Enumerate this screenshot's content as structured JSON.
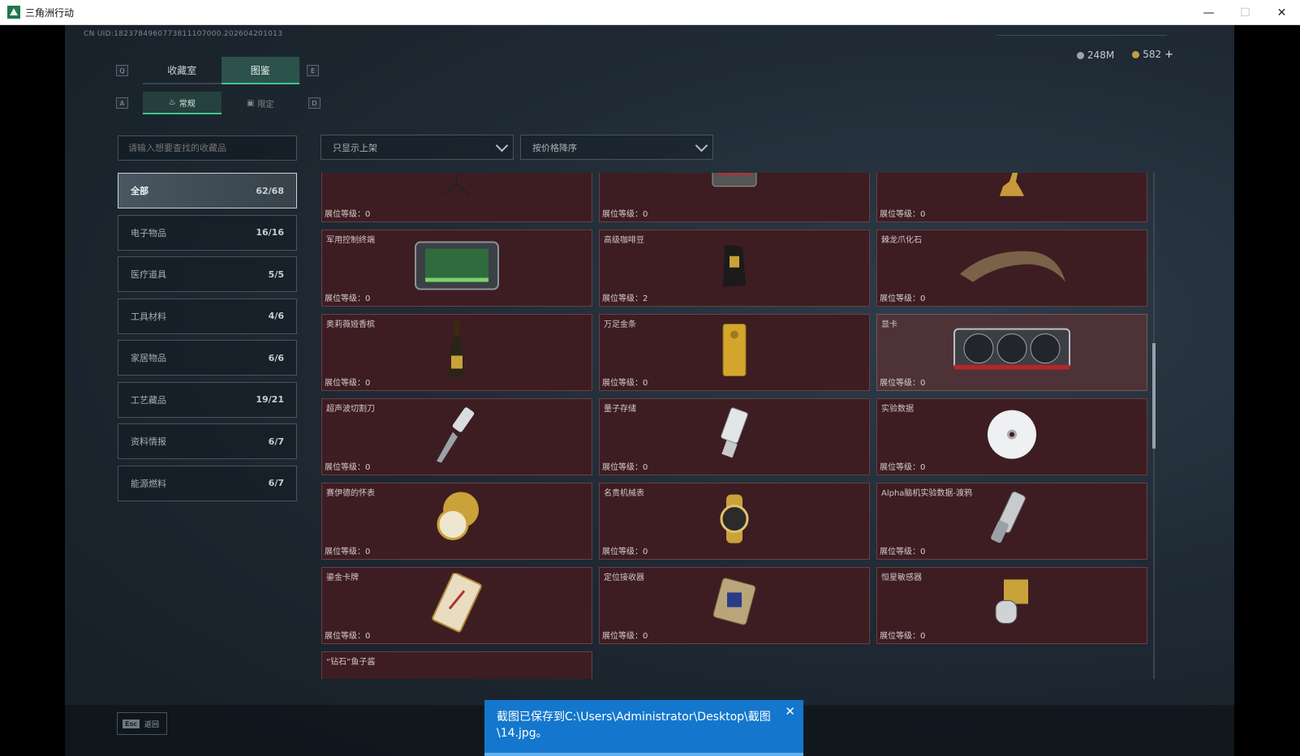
{
  "window": {
    "title": "三角洲行动",
    "controls": [
      "—",
      "☐",
      "✕"
    ]
  },
  "uid": "CN UID:1823784960773811107000.202604201013",
  "tabs": [
    {
      "label": "收藏室"
    },
    {
      "label": "图鉴"
    }
  ],
  "subtabs": [
    {
      "label": "常规"
    },
    {
      "label": "限定"
    }
  ],
  "key_hints": {
    "tab_left": "Q",
    "tab_right": "E",
    "sub_left": "A",
    "sub_right": "D"
  },
  "currency": {
    "silver": "248M",
    "gold": "582",
    "plus": "+"
  },
  "search": {
    "placeholder": "请输入想要查找的收藏品"
  },
  "filters": {
    "shelf": "只显示上架",
    "sort": "按价格降序"
  },
  "categories": [
    {
      "label": "全部",
      "count": "62/68"
    },
    {
      "label": "电子物品",
      "count": "16/16"
    },
    {
      "label": "医疗道具",
      "count": "5/5"
    },
    {
      "label": "工具材料",
      "count": "4/6"
    },
    {
      "label": "家居物品",
      "count": "6/6"
    },
    {
      "label": "工艺藏品",
      "count": "19/21"
    },
    {
      "label": "资料情报",
      "count": "6/7"
    },
    {
      "label": "能源燃料",
      "count": "6/7"
    }
  ],
  "level_prefix": "展位等级：",
  "items": [
    {
      "name": "",
      "level": "0",
      "icon": "satellite-dish-icon"
    },
    {
      "name": "",
      "level": "0",
      "icon": "tv-icon"
    },
    {
      "name": "",
      "level": "0",
      "icon": "gold-deer-icon"
    },
    {
      "name": "军用控制终端",
      "level": "0",
      "icon": "terminal-icon"
    },
    {
      "name": "高级咖啡豆",
      "level": "2",
      "icon": "coffee-bag-icon"
    },
    {
      "name": "棘龙爪化石",
      "level": "0",
      "icon": "claw-fossil-icon"
    },
    {
      "name": "奥莉薇娅香槟",
      "level": "0",
      "icon": "champagne-icon"
    },
    {
      "name": "万足金条",
      "level": "0",
      "icon": "gold-bar-icon"
    },
    {
      "name": "显卡",
      "level": "0",
      "icon": "graphics-card-icon"
    },
    {
      "name": "超声波切割刀",
      "level": "0",
      "icon": "cutter-icon"
    },
    {
      "name": "量子存储",
      "level": "0",
      "icon": "usb-drive-icon"
    },
    {
      "name": "实验数据",
      "level": "0",
      "icon": "disc-icon"
    },
    {
      "name": "赛伊德的怀表",
      "level": "0",
      "icon": "pocket-watch-icon"
    },
    {
      "name": "名贵机械表",
      "level": "0",
      "icon": "wristwatch-icon"
    },
    {
      "name": "Alpha脑机实验数据-渡鸦",
      "level": "0",
      "icon": "data-cylinder-icon"
    },
    {
      "name": "鎏金卡牌",
      "level": "0",
      "icon": "tarot-card-icon"
    },
    {
      "name": "定位接收器",
      "level": "0",
      "icon": "receiver-icon"
    },
    {
      "name": "恒星敏感器",
      "level": "0",
      "icon": "star-sensor-icon"
    },
    {
      "name": "“钻石”鱼子酱",
      "level": "",
      "icon": "caviar-tin-icon"
    }
  ],
  "footer": {
    "esc_key": "Esc",
    "esc_label": "返回"
  },
  "toast": {
    "message": "截图已保存到C:\\Users\\Administrator\\Desktop\\截图\\14.jpg。",
    "close": "✕"
  },
  "colors": {
    "accent": "#3fc58e",
    "card_bg": "#3d1d22",
    "toast_bg": "#1477cd"
  }
}
